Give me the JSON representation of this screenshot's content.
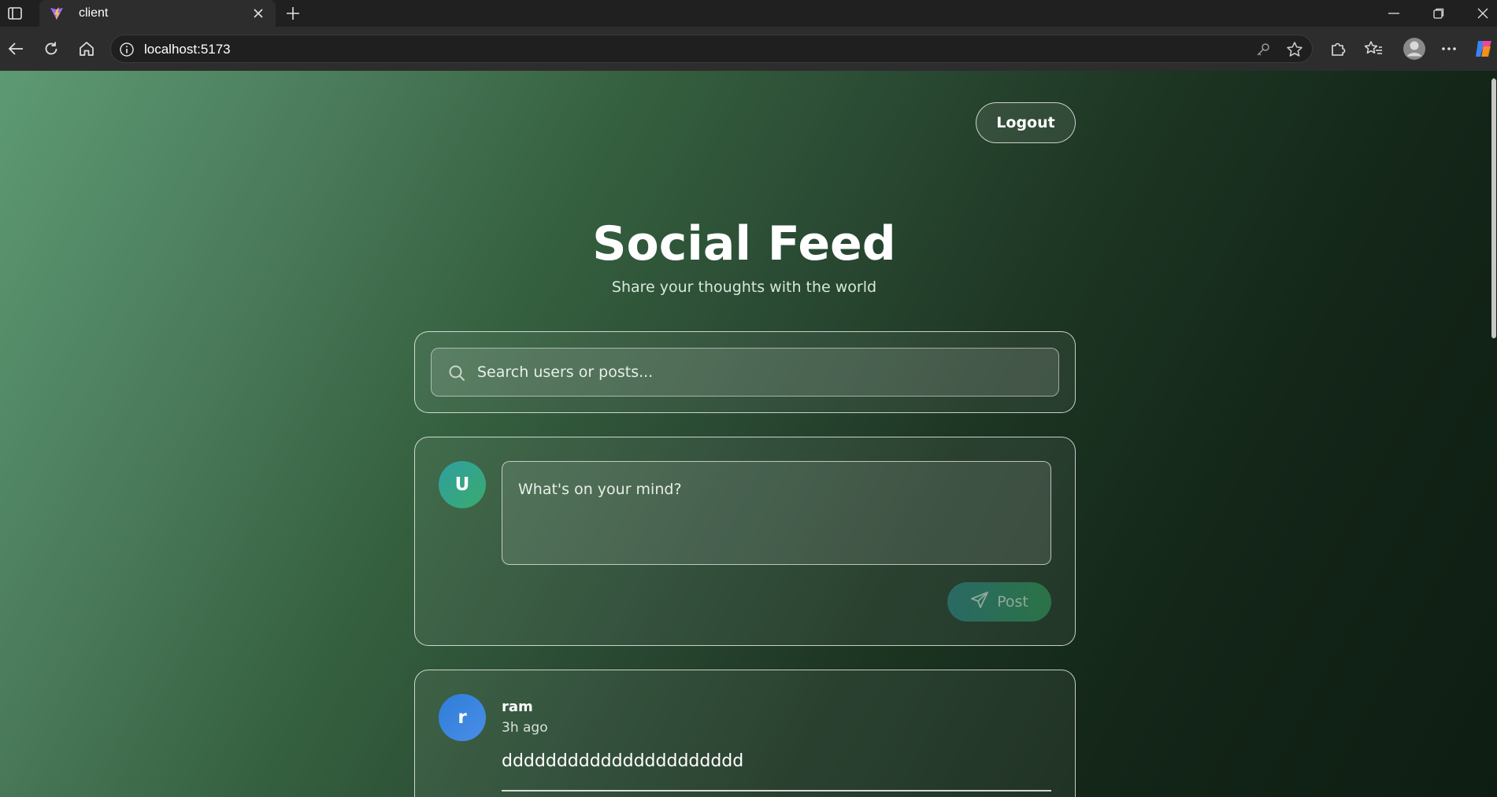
{
  "browser": {
    "tab_title": "client",
    "url": "localhost:5173",
    "icons": {
      "tab_actions": "tab-actions-icon",
      "favicon": "vite-logo-icon",
      "tab_close": "close-icon",
      "new_tab": "plus-icon",
      "minimize": "minimize-icon",
      "restore": "restore-icon",
      "close_window": "close-icon",
      "back": "back-arrow-icon",
      "refresh": "refresh-icon",
      "home": "home-icon",
      "site_info": "info-icon",
      "passwords": "key-icon",
      "favorite": "star-icon",
      "extensions": "puzzle-icon",
      "favorites": "favorites-icon",
      "profile": "profile-icon",
      "more": "more-icon",
      "copilot": "copilot-icon"
    }
  },
  "header": {
    "logout_label": "Logout",
    "title": "Social Feed",
    "subtitle": "Share your thoughts with the world"
  },
  "search": {
    "placeholder": "Search users or posts...",
    "value": ""
  },
  "compose": {
    "avatar_initial": "U",
    "placeholder": "What's on your mind?",
    "value": "",
    "post_label": "Post"
  },
  "posts": [
    {
      "avatar_initial": "r",
      "username": "ram",
      "time": "3h ago",
      "content": "dddddddddddddddddddddd"
    }
  ],
  "colors": {
    "bg_light": "#5d9a73",
    "bg_dark": "#0e1d12",
    "avatar_u": "#2fa0a0",
    "avatar_r": "#2e7dd8",
    "post_button": "#2e8a52"
  }
}
